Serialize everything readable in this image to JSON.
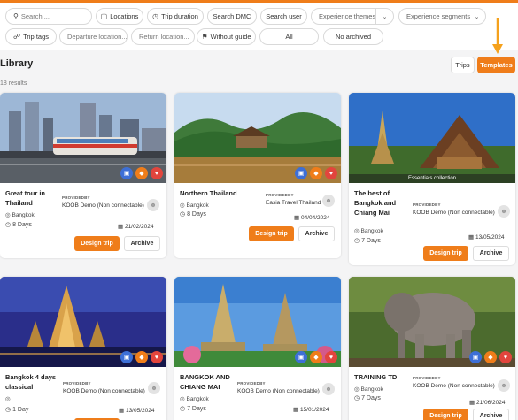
{
  "filters": {
    "search_placeholder": "Search ...",
    "locations": "Locations",
    "trip_duration": "Trip duration",
    "search_dmc": "Search DMC",
    "search_user": "Search user",
    "experience_themes": "Experience themes",
    "experience_segments": "Experience segments",
    "trip_tags": "Trip tags",
    "departure_location": "Departure location...",
    "return_location": "Return location...",
    "without_guide": "Without guide",
    "all": "All",
    "no_archived": "No archived"
  },
  "page": {
    "title": "Library",
    "results": "18 results"
  },
  "view_toggle": {
    "trips": "Trips",
    "templates": "Templates"
  },
  "labels": {
    "provided_by": "PROVIDEDBY",
    "design_trip": "Design trip",
    "archive": "Archive"
  },
  "colors": {
    "accent": "#ef7d1a",
    "blue": "#3d6fd6",
    "red": "#e2453d"
  },
  "cards": [
    {
      "name": "Great tour in Thailand",
      "location": "Bangkok",
      "days": "8 Days",
      "provider": "KOOB Demo (Non connectable)",
      "date": "21/02/2024",
      "badge": ""
    },
    {
      "name": "Northern Thailand",
      "location": "Bangkok",
      "days": "8 Days",
      "provider": "Easia Travel Thailand",
      "date": "04/04/2024",
      "badge": ""
    },
    {
      "name": "The best of Bangkok and Chiang Mai",
      "location": "Bangkok",
      "days": "7 Days",
      "provider": "KOOB Demo (Non connectable)",
      "date": "13/05/2024",
      "badge": "Essentials collection"
    },
    {
      "name": "Bangkok 4 days classical",
      "location": "",
      "days": "1 Day",
      "provider": "KOOB Demo (Non connectable)",
      "date": "13/05/2024",
      "badge": ""
    },
    {
      "name": "BANGKOK AND CHIANG MAI",
      "location": "Bangkok",
      "days": "7 Days",
      "provider": "KOOB Demo (Non connectable)",
      "date": "15/01/2024",
      "badge": ""
    },
    {
      "name": "TRAINING TD",
      "location": "Bangkok",
      "days": "7 Days",
      "provider": "KOOB Demo (Non connectable)",
      "date": "21/06/2024",
      "badge": ""
    }
  ]
}
